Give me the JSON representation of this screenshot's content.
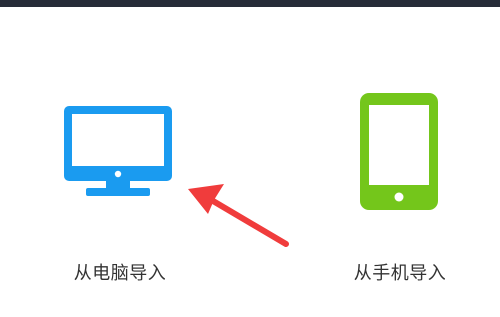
{
  "colors": {
    "top_bar": "#272c38",
    "pc_accent": "#1a9bf0",
    "phone_accent": "#74c61b",
    "arrow": "#f03c3c",
    "label_text": "#333333"
  },
  "options": {
    "pc": {
      "label": "从电脑导入",
      "icon": "monitor-icon"
    },
    "phone": {
      "label": "从手机导入",
      "icon": "phone-icon"
    }
  },
  "annotation": {
    "icon": "red-arrow-icon"
  }
}
